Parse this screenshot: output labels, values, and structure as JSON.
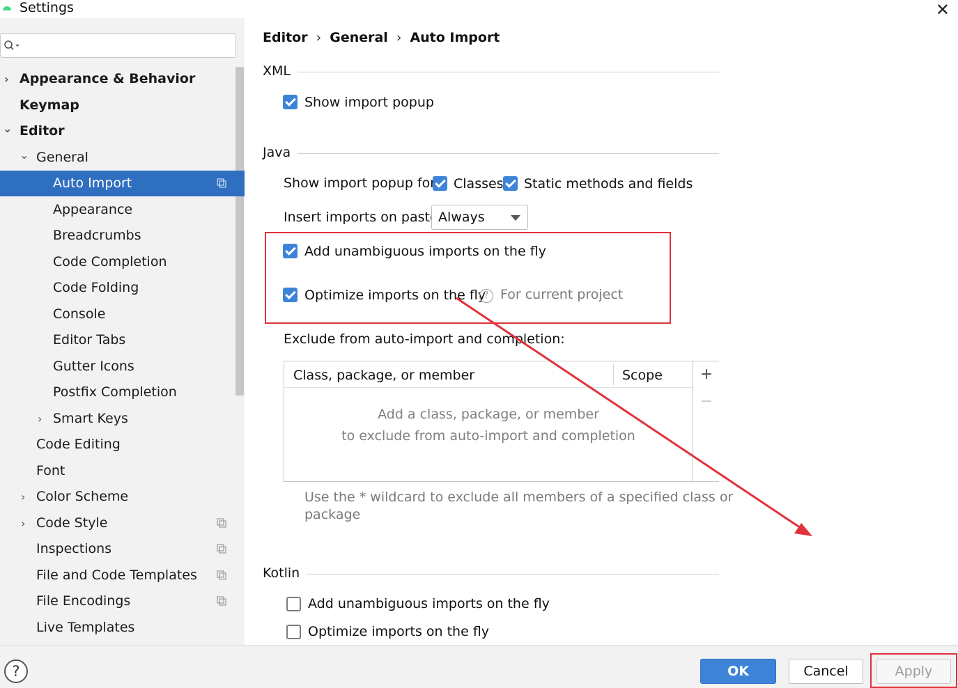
{
  "window": {
    "title": "Settings",
    "close_symbol": "✕"
  },
  "search": {
    "placeholder": ""
  },
  "sidebar": {
    "items": [
      {
        "label": "Appearance & Behavior",
        "chev": "›"
      },
      {
        "label": "Keymap",
        "chev": ""
      },
      {
        "label": "Editor",
        "chev": "⌄"
      },
      {
        "label": "General",
        "chev": "⌄"
      },
      {
        "label": "Auto Import",
        "chev": ""
      },
      {
        "label": "Appearance",
        "chev": ""
      },
      {
        "label": "Breadcrumbs",
        "chev": ""
      },
      {
        "label": "Code Completion",
        "chev": ""
      },
      {
        "label": "Code Folding",
        "chev": ""
      },
      {
        "label": "Console",
        "chev": ""
      },
      {
        "label": "Editor Tabs",
        "chev": ""
      },
      {
        "label": "Gutter Icons",
        "chev": ""
      },
      {
        "label": "Postfix Completion",
        "chev": ""
      },
      {
        "label": "Smart Keys",
        "chev": "›"
      },
      {
        "label": "Code Editing",
        "chev": ""
      },
      {
        "label": "Font",
        "chev": ""
      },
      {
        "label": "Color Scheme",
        "chev": "›"
      },
      {
        "label": "Code Style",
        "chev": "›"
      },
      {
        "label": "Inspections",
        "chev": ""
      },
      {
        "label": "File and Code Templates",
        "chev": ""
      },
      {
        "label": "File Encodings",
        "chev": ""
      },
      {
        "label": "Live Templates",
        "chev": ""
      }
    ]
  },
  "breadcrumb": {
    "part1": "Editor",
    "part2": "General",
    "part3": "Auto Import",
    "sep": "›"
  },
  "xml": {
    "title": "XML",
    "show_import_popup": {
      "label": "Show import popup",
      "checked": true
    }
  },
  "java": {
    "title": "Java",
    "popup_for_label": "Show import popup for:",
    "classes": {
      "label": "Classes",
      "checked": true
    },
    "static_methods": {
      "label": "Static methods and fields",
      "checked": true
    },
    "insert_on_paste_label": "Insert imports on paste:",
    "insert_on_paste_value": "Always",
    "add_unambiguous": {
      "label": "Add unambiguous imports on the fly",
      "checked": true
    },
    "optimize": {
      "label": "Optimize imports on the fly",
      "checked": true
    },
    "help_symbol": "?",
    "for_current_project": "For current project",
    "exclude_label": "Exclude from auto-import and completion:",
    "table": {
      "col1": "Class, package, or member",
      "col2": "Scope",
      "empty_line1": "Add a class, package, or member",
      "empty_line2": "to exclude from auto-import and completion",
      "add_symbol": "+",
      "remove_symbol": "−"
    },
    "hint_line1": "Use the * wildcard to exclude all members of a specified class or",
    "hint_line2": "package"
  },
  "kotlin": {
    "title": "Kotlin",
    "add_unambiguous": {
      "label": "Add unambiguous imports on the fly",
      "checked": false
    },
    "optimize": {
      "label": "Optimize imports on the fly",
      "checked": false
    }
  },
  "buttons": {
    "help": "?",
    "ok": "OK",
    "cancel": "Cancel",
    "apply": "Apply"
  },
  "annotation": {
    "color": "#e2323c"
  },
  "colors": {
    "accent": "#3d84d9",
    "selection": "#2f6fbf"
  }
}
